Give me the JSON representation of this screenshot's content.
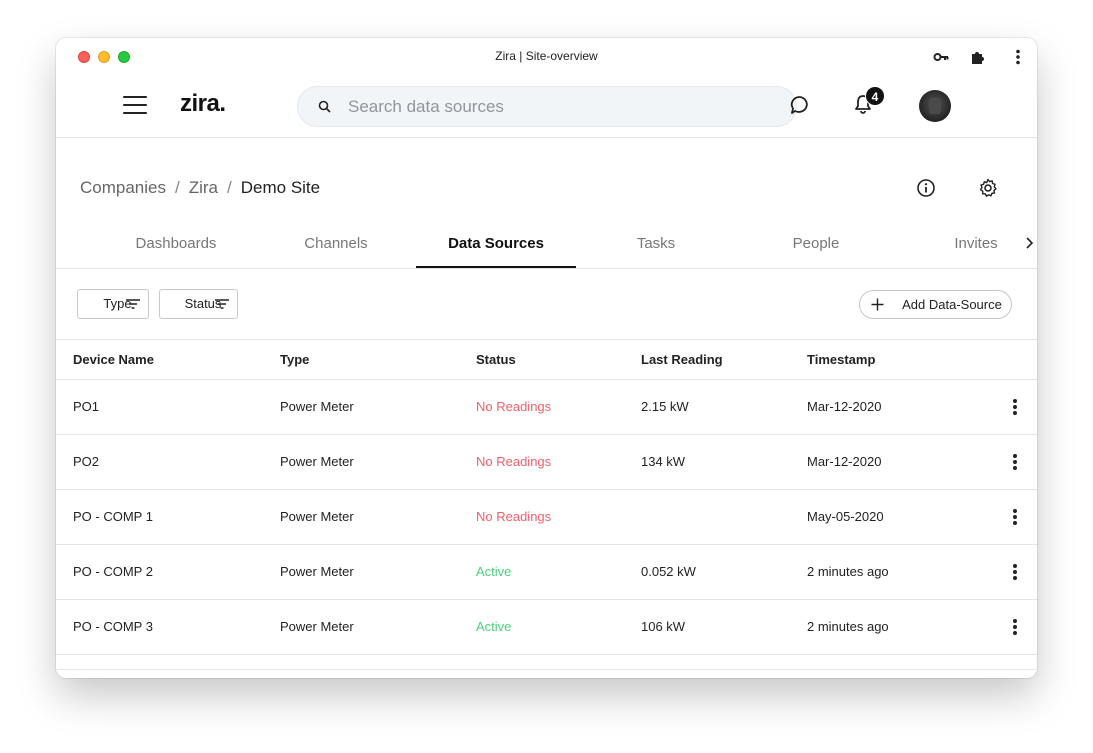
{
  "window": {
    "title": "Zira | Site-overview"
  },
  "header": {
    "logo": "zira.",
    "search_placeholder": "Search data sources",
    "notification_count": "4"
  },
  "breadcrumb": {
    "items": [
      "Companies",
      "Zira",
      "Demo Site"
    ],
    "separator": "/"
  },
  "tabs": [
    {
      "label": "Dashboards"
    },
    {
      "label": "Channels"
    },
    {
      "label": "Data Sources",
      "active": true
    },
    {
      "label": "Tasks"
    },
    {
      "label": "People"
    },
    {
      "label": "Invites"
    }
  ],
  "filters": {
    "type_label": "Type",
    "status_label": "Status",
    "add_label": "Add Data-Source"
  },
  "table": {
    "columns": [
      "Device Name",
      "Type",
      "Status",
      "Last Reading",
      "Timestamp"
    ],
    "rows": [
      {
        "name": "PO1",
        "type": "Power Meter",
        "status": "No Readings",
        "reading": "2.15 kW",
        "timestamp": "Mar-12-2020"
      },
      {
        "name": "PO2",
        "type": "Power Meter",
        "status": "No Readings",
        "reading": "134 kW",
        "timestamp": "Mar-12-2020"
      },
      {
        "name": "PO - COMP 1",
        "type": "Power Meter",
        "status": "No Readings",
        "reading": "",
        "timestamp": "May-05-2020"
      },
      {
        "name": "PO - COMP 2",
        "type": "Power Meter",
        "status": "Active",
        "reading": "0.052 kW",
        "timestamp": "2 minutes ago"
      },
      {
        "name": "PO - COMP 3",
        "type": "Power Meter",
        "status": "Active",
        "reading": "106 kW",
        "timestamp": "2 minutes ago"
      }
    ]
  },
  "colors": {
    "status_no_readings": "#f0616a",
    "status_active": "#4cd17a",
    "accent": "#111111"
  }
}
